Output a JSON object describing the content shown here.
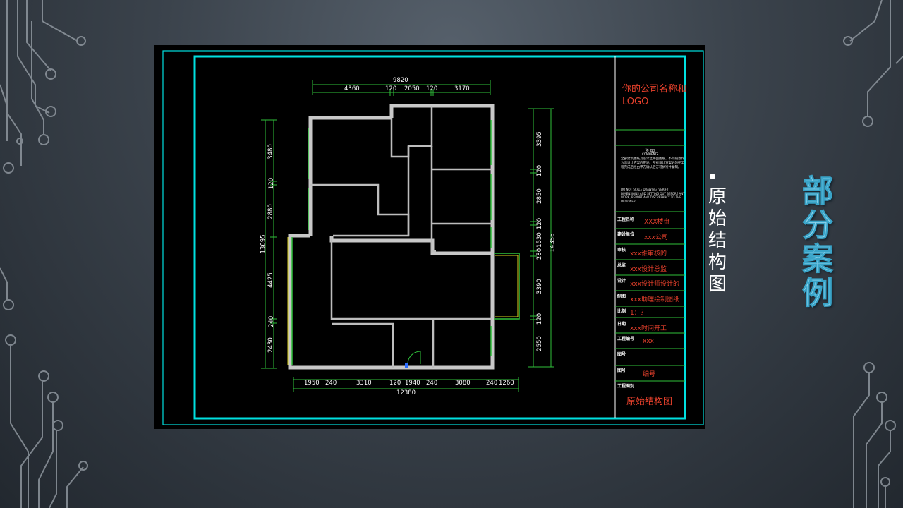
{
  "slide": {
    "title": "部分案例",
    "bullet": "原始结构图"
  },
  "drawing": {
    "company": "你的公司名称和LOGO",
    "notes_heading": "说 明",
    "notes_subheading": "COMMENTS",
    "notes_cn": "全部建筑图纸及设计之书面图纸，不得随意作为出设计方案的用途。所有设计方案必须在工程完成后经由甲方确认后方可执行并复制。",
    "notes_en": "do not scale drawing, verify dimensions and setting out before any work, report any discrepancy to the designer",
    "title_block": [
      {
        "label": "工程名称",
        "value": "XXX楼盘"
      },
      {
        "label": "建设单位",
        "value": "xxx公司"
      },
      {
        "label": "审核",
        "value": "xxx谁审核的"
      },
      {
        "label": "总监",
        "value": "xxx设计总监"
      },
      {
        "label": "设计",
        "value": "xxx设计师设计的"
      },
      {
        "label": "制图",
        "value": "xxx助理绘制图纸"
      },
      {
        "label": "比例",
        "value": "1：？"
      },
      {
        "label": "日期",
        "value": "xxx时间开工"
      },
      {
        "label": "工程编号",
        "value": "xxx"
      },
      {
        "label": "图号",
        "value": ""
      },
      {
        "label": "图号",
        "value": "编号"
      },
      {
        "label": "工程图别",
        "value": ""
      }
    ],
    "drawing_title": "原始结构图",
    "dims_top": [
      "9820",
      "4360",
      "120",
      "2050",
      "120",
      "3170"
    ],
    "dims_bottom": [
      "1950",
      "240",
      "3310",
      "120",
      "1940",
      "240",
      "3080",
      "240",
      "1260",
      "12380"
    ],
    "dims_left": [
      "3480",
      "120",
      "2880",
      "13695",
      "4425",
      "240",
      "2430"
    ],
    "dims_right": [
      "3395",
      "120",
      "2850",
      "120",
      "1530",
      "280",
      "14356",
      "3390",
      "120",
      "2550"
    ]
  }
}
